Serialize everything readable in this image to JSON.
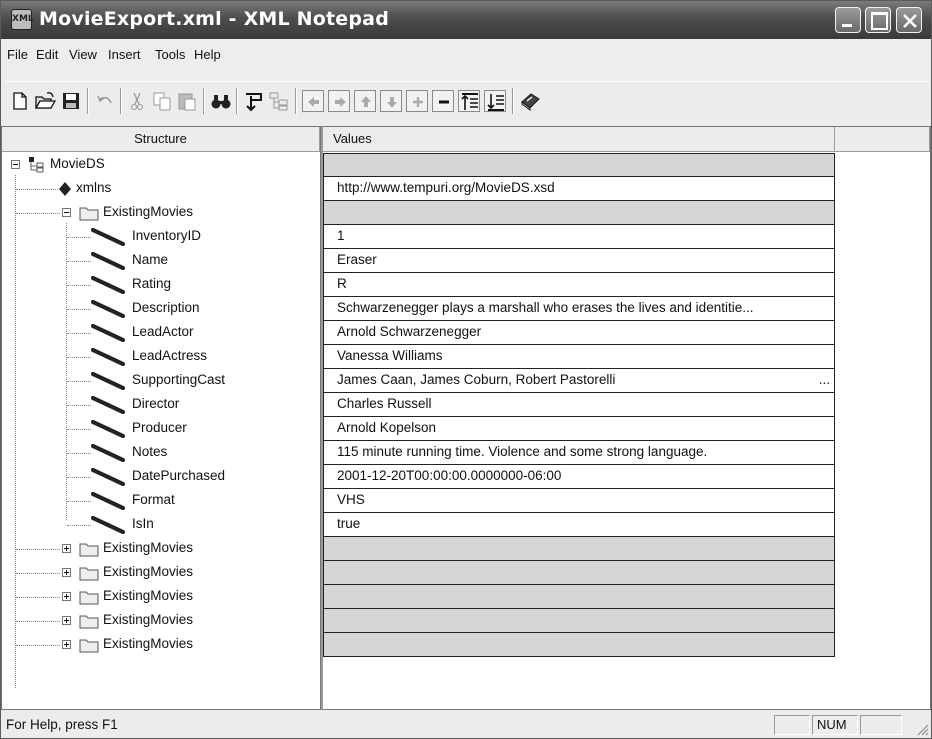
{
  "window": {
    "title": "MovieExport.xml - XML Notepad",
    "app_icon_label": "XML"
  },
  "menu": {
    "items": [
      "File",
      "Edit",
      "View",
      "Insert",
      "Tools",
      "Help"
    ]
  },
  "toolbar": {
    "buttons": [
      "new-icon",
      "open-icon",
      "save-icon",
      "undo-icon",
      "cut-icon",
      "copy-icon",
      "paste-icon",
      "find-icon",
      "insert-child-icon",
      "change-to-icon",
      "move-left-icon",
      "move-right-icon",
      "move-up-icon",
      "move-down-icon",
      "add-icon",
      "remove-icon",
      "insert-before-icon",
      "insert-after-icon",
      "validate-icon"
    ]
  },
  "columns": {
    "structure": "Structure",
    "values": "Values"
  },
  "tree": {
    "root": "MovieDS",
    "attribute": "xmlns",
    "expanded_group": "ExistingMovies",
    "fields": [
      "InventoryID",
      "Name",
      "Rating",
      "Description",
      "LeadActor",
      "LeadActress",
      "SupportingCast",
      "Director",
      "Producer",
      "Notes",
      "DatePurchased",
      "Format",
      "IsIn"
    ],
    "collapsed_groups": [
      "ExistingMovies",
      "ExistingMovies",
      "ExistingMovies",
      "ExistingMovies",
      "ExistingMovies"
    ]
  },
  "values": {
    "xmlns": "http://www.tempuri.org/MovieDS.xsd",
    "fields": [
      "1",
      "Eraser",
      "R",
      "Schwarzenegger plays a marshall who erases the lives and identitie...",
      "Arnold Schwarzenegger",
      "Vanessa Williams",
      "James Caan, James Coburn, Robert Pastorelli",
      "Charles Russell",
      "Arnold Kopelson",
      "115 minute running time. Violence and some strong language.",
      "2001-12-20T00:00:00.0000000-06:00",
      "VHS",
      "true"
    ],
    "supporting_cast_ellipsis": "..."
  },
  "status": {
    "help_text": "For Help, press F1",
    "num": "NUM"
  }
}
